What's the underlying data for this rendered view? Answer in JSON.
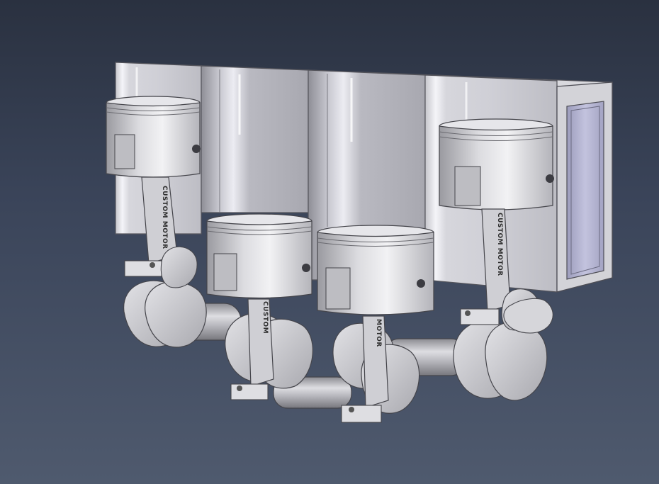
{
  "viewport": {
    "background_top": "#2a3140",
    "background_bottom": "#4f5a6e"
  },
  "model": {
    "rod_engraving": "CUSTOM MOTOR",
    "rod_engraving_partial": "CUSTOM",
    "rod_engraving_short": "MOTOR"
  }
}
